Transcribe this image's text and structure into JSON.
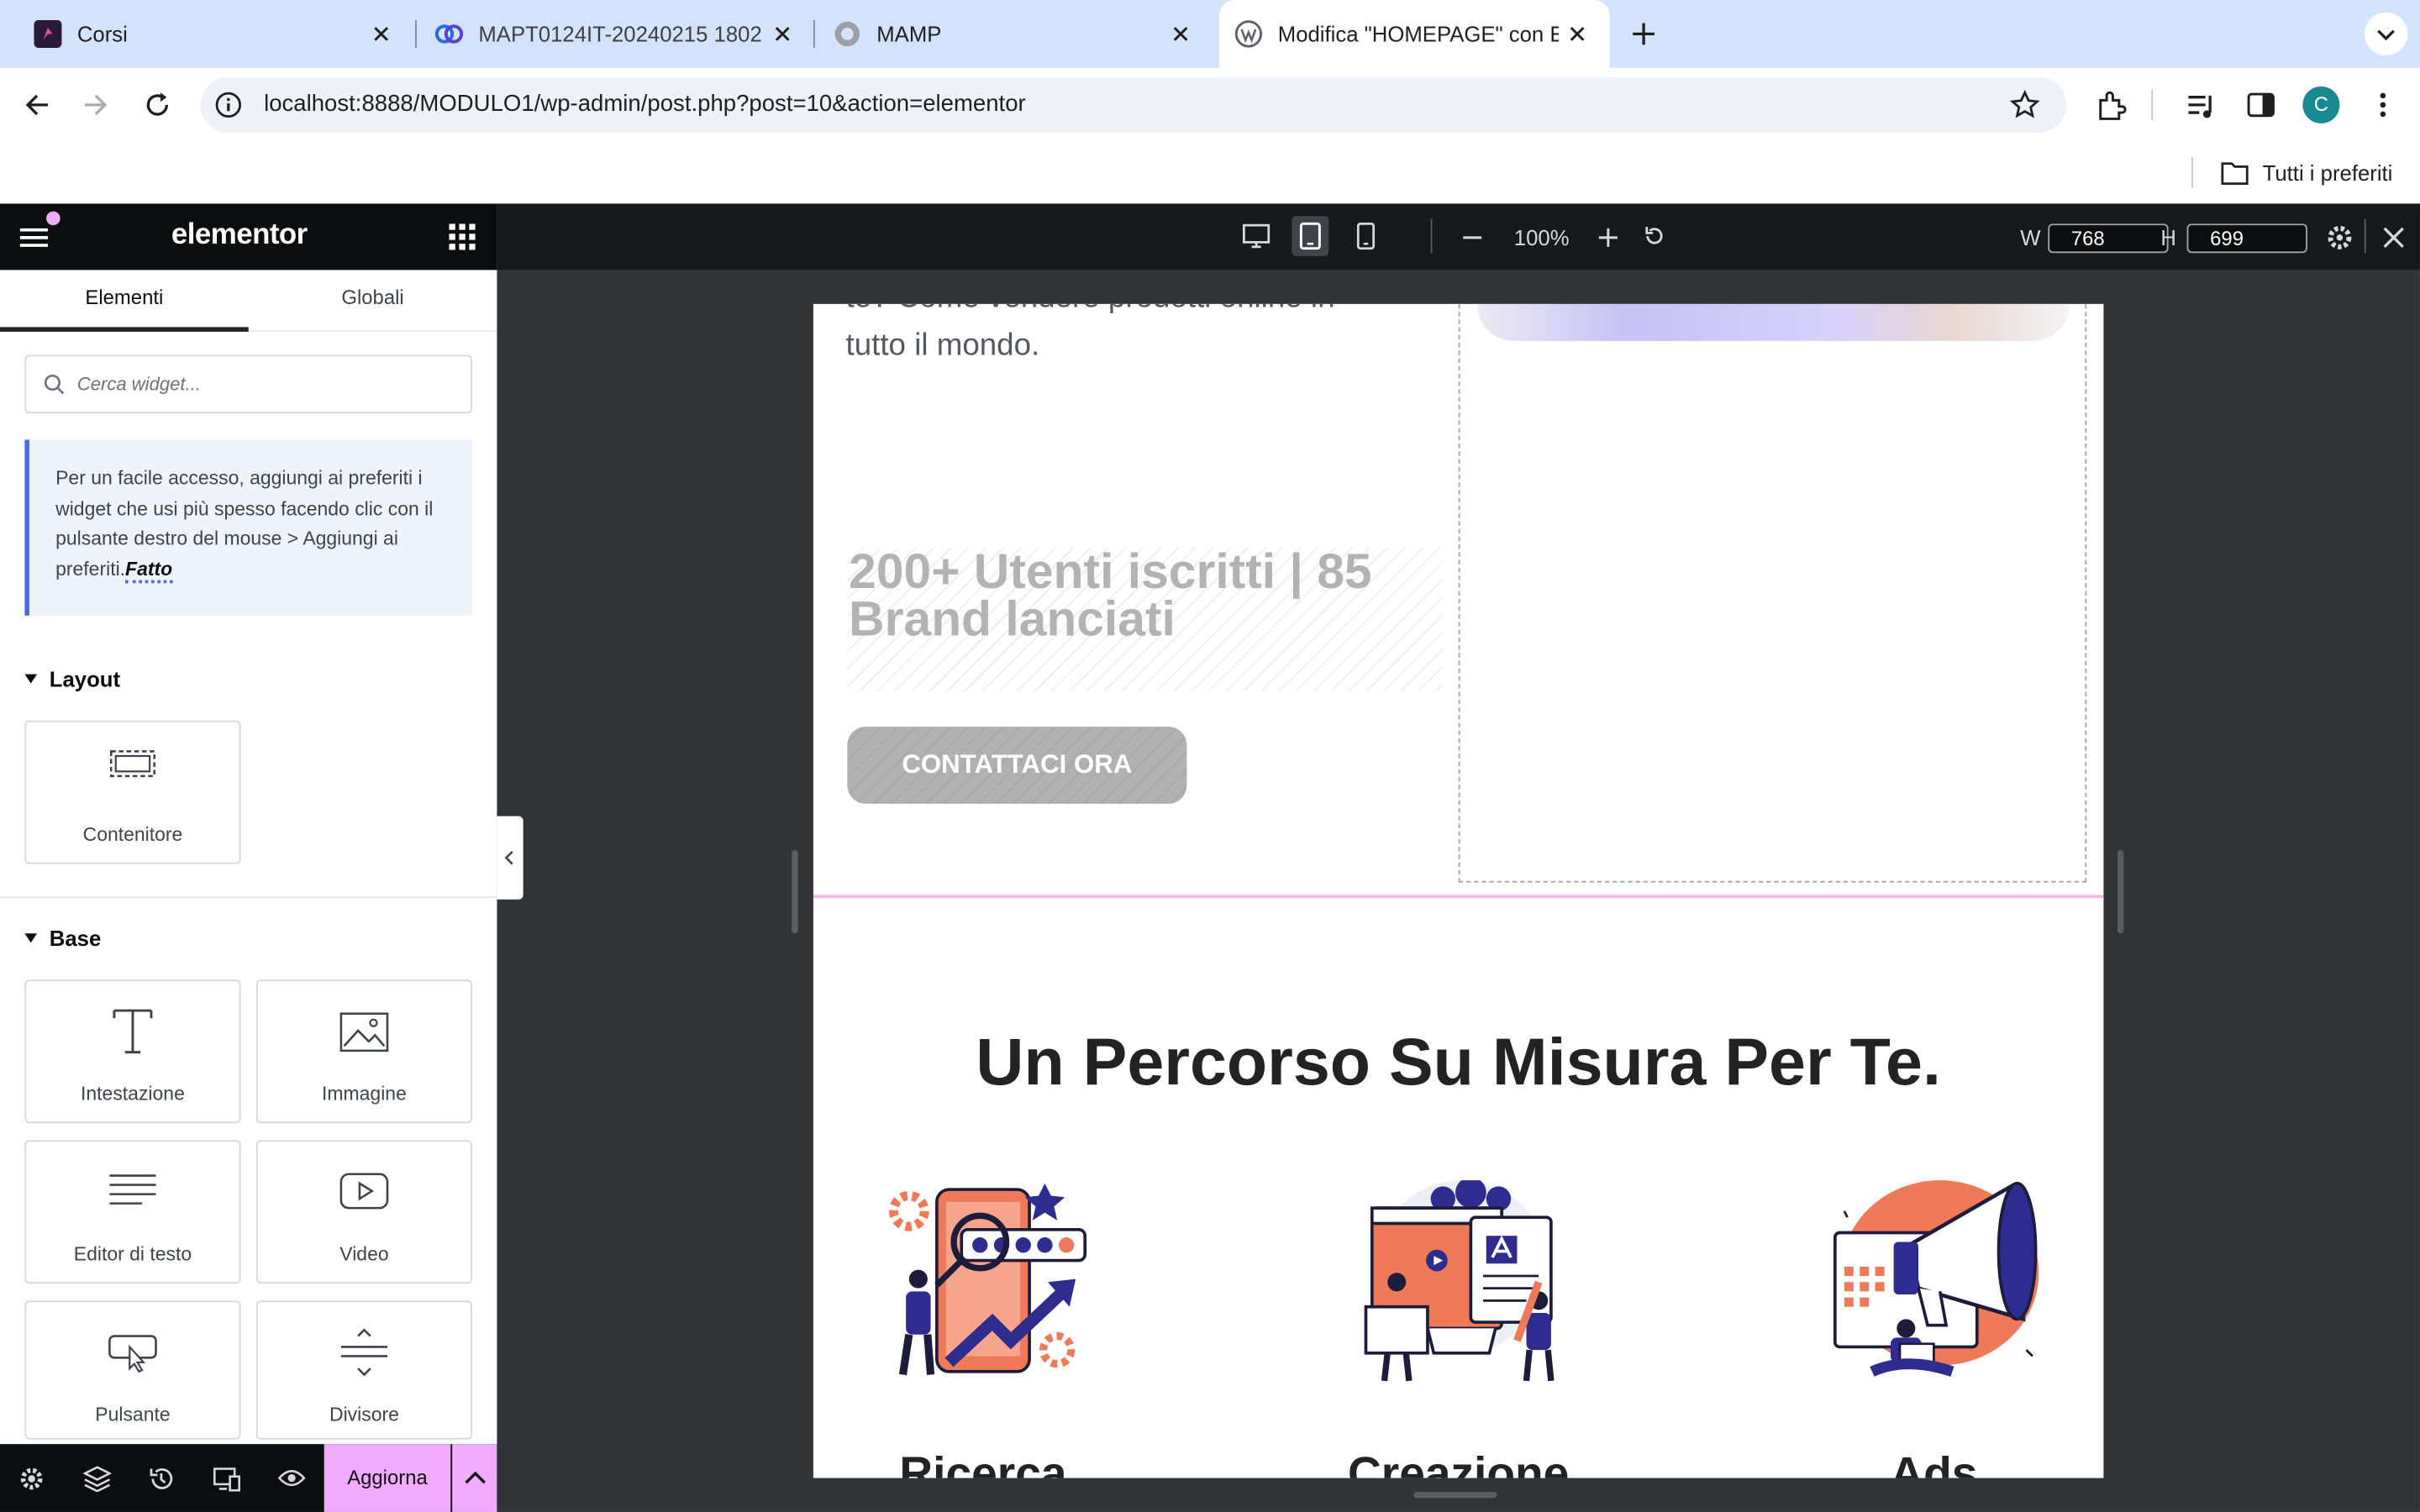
{
  "browser": {
    "tabs": [
      {
        "title": "Corsi",
        "favicon": "corsi-favicon"
      },
      {
        "title": "MAPT0124IT-20240215 1802",
        "favicon": "zoom-favicon"
      },
      {
        "title": "MAMP",
        "favicon": "mamp-favicon"
      },
      {
        "title": "Modifica \"HOMEPAGE\" con El",
        "favicon": "wordpress-favicon",
        "active": true
      }
    ],
    "url": "localhost:8888/MODULO1/wp-admin/post.php?post=10&action=elementor",
    "profile_initial": "C",
    "bookmarks_label": "Tutti i preferiti"
  },
  "panel": {
    "logo": "elementor",
    "tabs": [
      "Elementi",
      "Globali"
    ],
    "search_placeholder": "Cerca widget...",
    "tip_text": "Per un facile accesso, aggiungi ai preferiti i widget che usi più spesso facendo clic con il pulsante destro del mouse > Aggiungi ai preferiti.",
    "tip_link": "Fatto",
    "sections": [
      {
        "title": "Layout",
        "widgets": [
          {
            "label": "Contenitore",
            "icon": "container-icon"
          }
        ]
      },
      {
        "title": "Base",
        "widgets": [
          {
            "label": "Intestazione",
            "icon": "heading-icon"
          },
          {
            "label": "Immagine",
            "icon": "image-icon"
          },
          {
            "label": "Editor di testo",
            "icon": "text-editor-icon"
          },
          {
            "label": "Video",
            "icon": "video-icon"
          },
          {
            "label": "Pulsante",
            "icon": "button-icon"
          },
          {
            "label": "Divisore",
            "icon": "divider-icon"
          }
        ]
      }
    ],
    "footer": {
      "update_label": "Aggiorna"
    }
  },
  "topbar": {
    "zoom": "100%",
    "width_label": "W",
    "width_value": "768",
    "height_label": "H",
    "height_value": "699"
  },
  "canvas": {
    "partial_text_top": "te? Come vendere prodotti online in",
    "text_line": "tutto il mondo.",
    "stats_line1": "200+ Utenti iscritti | 85",
    "stats_line2": "Brand lanciati",
    "cta_label": "CONTATTACI ORA",
    "section_title": "Un Percorso Su Misura Per Te.",
    "cards": [
      {
        "label": "Ricerca",
        "illustration": "research-illustration"
      },
      {
        "label": "Creazione",
        "illustration": "creation-illustration"
      },
      {
        "label": "Ads",
        "illustration": "ads-illustration"
      }
    ]
  },
  "colors": {
    "chrome_tabbar": "#d3e3fd",
    "elementor_dark": "#0c0d0e",
    "accent_pink": "#f0abfc",
    "illustration_orange": "#ef7a5a",
    "illustration_navy": "#2e2c8f"
  }
}
